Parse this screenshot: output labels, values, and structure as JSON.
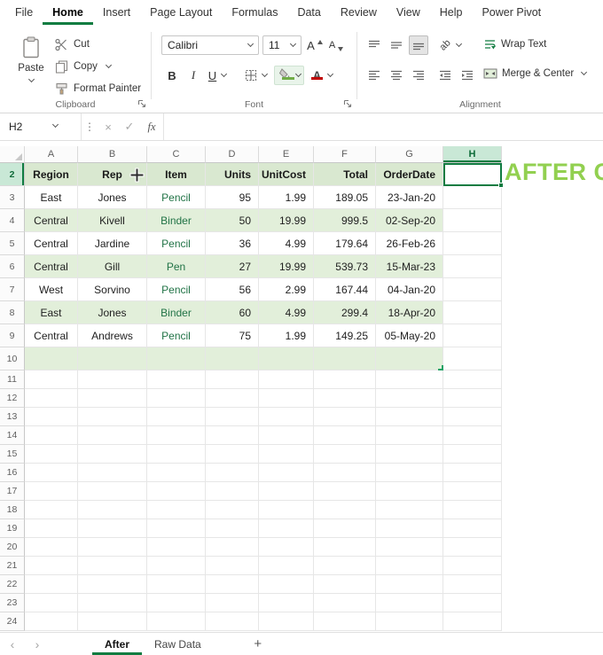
{
  "app": {
    "tabs": [
      {
        "label": "File",
        "active": false
      },
      {
        "label": "Home",
        "active": true
      },
      {
        "label": "Insert",
        "active": false
      },
      {
        "label": "Page Layout",
        "active": false
      },
      {
        "label": "Formulas",
        "active": false
      },
      {
        "label": "Data",
        "active": false
      },
      {
        "label": "Review",
        "active": false
      },
      {
        "label": "View",
        "active": false
      },
      {
        "label": "Help",
        "active": false
      },
      {
        "label": "Power Pivot",
        "active": false
      }
    ]
  },
  "ribbon": {
    "clipboard": {
      "label": "Clipboard",
      "paste": "Paste",
      "cut": "Cut",
      "copy": "Copy",
      "format_painter": "Format Painter"
    },
    "font": {
      "label": "Font",
      "family": "Calibri",
      "size": "11",
      "bold": "B",
      "italic": "I",
      "underline": "U"
    },
    "alignment": {
      "label": "Alignment",
      "wrap_text": "Wrap Text",
      "merge_center": "Merge & Center"
    }
  },
  "icons": {
    "font_letter": "A",
    "orientation": "ab",
    "paste": "clipboard",
    "cut": "scissors",
    "copy": "two-pages",
    "format_painter": "brush",
    "borders": "grid",
    "fill_color": "paint-bucket",
    "font_color": "letter-A-red-bar",
    "dialog_launcher": "corner-arrow",
    "dropdown": "chevron-down"
  },
  "formula_bar": {
    "name_box": "H2",
    "more_icon": "⋮",
    "cancel_icon": "×",
    "enter_icon": "✓",
    "fx_icon": "fx",
    "value": ""
  },
  "grid": {
    "col_headers": [
      "A",
      "B",
      "C",
      "D",
      "E",
      "F",
      "G",
      "H"
    ],
    "row_numbers": [
      "2",
      "3",
      "4",
      "5",
      "6",
      "7",
      "8",
      "9",
      "10",
      "11",
      "12",
      "13",
      "14",
      "15",
      "16",
      "17",
      "18",
      "19",
      "20",
      "21",
      "22",
      "23",
      "24"
    ],
    "selected_cell": "H2",
    "overlay_text": "AFTER CL"
  },
  "table": {
    "headers": [
      "Region",
      "Rep",
      "Item",
      "Units",
      "UnitCost",
      "Total",
      "OrderDate"
    ],
    "rows": [
      [
        "East",
        "Jones",
        "Pencil",
        "95",
        "1.99",
        "189.05",
        "23-Jan-20"
      ],
      [
        "Central",
        "Kivell",
        "Binder",
        "50",
        "19.99",
        "999.5",
        "02-Sep-20"
      ],
      [
        "Central",
        "Jardine",
        "Pencil",
        "36",
        "4.99",
        "179.64",
        "26-Feb-26"
      ],
      [
        "Central",
        "Gill",
        "Pen",
        "27",
        "19.99",
        "539.73",
        "15-Mar-23"
      ],
      [
        "West",
        "Sorvino",
        "Pencil",
        "56",
        "2.99",
        "167.44",
        "04-Jan-20"
      ],
      [
        "East",
        "Jones",
        "Binder",
        "60",
        "4.99",
        "299.4",
        "18-Apr-20"
      ],
      [
        "Central",
        "Andrews",
        "Pencil",
        "75",
        "1.99",
        "149.25",
        "05-May-20"
      ]
    ]
  },
  "sheet_bar": {
    "prev_icon": "‹",
    "next_icon": "›",
    "add_icon": "+",
    "tabs": [
      {
        "label": "After",
        "active": true
      },
      {
        "label": "Raw Data",
        "active": false
      }
    ]
  },
  "colors": {
    "accent": "#107C41",
    "band": "#E2EFDA",
    "header_row": "#D9E8D0",
    "overlay_green": "#92D050",
    "item_text": "#217346",
    "selection_header": "#C9E8D6"
  }
}
